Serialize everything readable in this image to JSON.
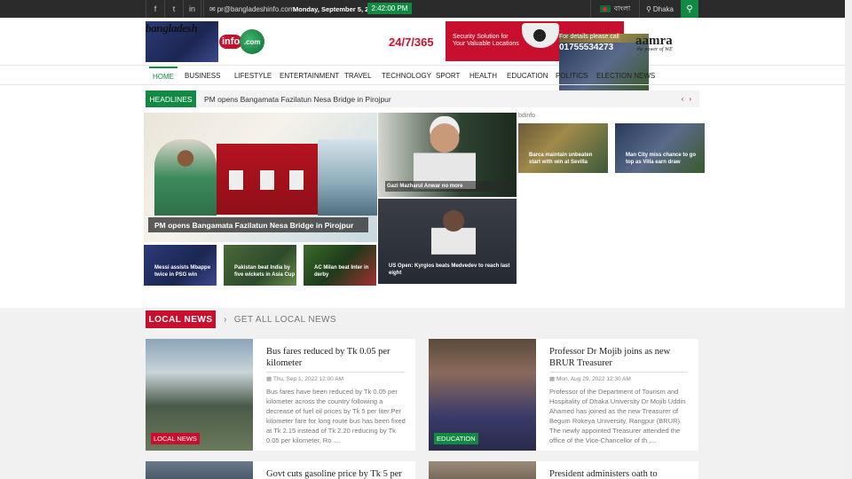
{
  "topbar": {
    "social": [
      "f",
      "t",
      "in"
    ],
    "email": "pr@bangladeshinfo.com",
    "date": "Monday, September 5, 2022",
    "time": "2:42:00 PM",
    "language": "বাংলা",
    "city": "Dhaka"
  },
  "header": {
    "logo_text": "bangladesh",
    "logo_pill": "info",
    "logo_globe": ".com",
    "ad_247": "24/7/365",
    "ad_left": "Security Solution for Your Valuable Locations",
    "ad_right_1": "For details please call",
    "ad_right_2": "01755534273",
    "brand": "aamra",
    "brand_tagline": "the power of WE"
  },
  "nav": [
    "HOME",
    "BUSINESS",
    "LIFESTYLE",
    "ENTERTAINMENT",
    "TRAVEL",
    "TECHNOLOGY",
    "SPORT",
    "HEALTH",
    "EDUCATION",
    "POLITICS",
    "ELECTION NEWS"
  ],
  "headlines": {
    "label": "HEADLINES",
    "text": "PM opens Bangamata Fazilatun Nesa Bridge in Pirojpur",
    "arrows": "‹ ›"
  },
  "hero": {
    "main_caption": "PM opens Bangamata Fazilatun Nesa Bridge in Pirojpur",
    "top_right_caption": "Gazi Mazharul Anwar no more",
    "bottom_right_caption": "US Open: Kyrgios beats Medvedev to reach last eight",
    "broken_image_alt": "bdinfo",
    "side_1": "Barca maintain unbeaten start with win at Sevilla",
    "side_2": "Man City miss chance to go top as Villa earn draw",
    "thumb_1": "Messi assists Mbappe twice in PSG win",
    "thumb_2": "Pakistan beat India by five wickets in Asia Cup",
    "thumb_3": "AC Milan beat Inter in derby"
  },
  "local_news": {
    "title": "LOCAL NEWS",
    "more": "GET ALL LOCAL NEWS",
    "cards": [
      {
        "badge": "LOCAL NEWS",
        "title": "Bus fares reduced by Tk 0.05 per kilometer",
        "date": "Thu, Sep 1, 2022 12:00 AM",
        "excerpt": "Bus fares have been reduced by Tk 0.05 per kilometer across the country following a decrease of fuel oil prices by Tk 5 per liter.Per kilometer fare for long route bus has been fixed at Tk 2.15 instead of Tk 2.20 reducing by Tk 0.05 per kilometer, Ro ...."
      },
      {
        "badge": "EDUCATION",
        "title": "Professor Dr Mojib joins as new BRUR Treasurer",
        "date": "Mon, Aug 29, 2022 12:30 AM",
        "excerpt": "Professor of the Department of Tourism and Hospitality of Dhaka University Dr Mojib Uddin Ahamed has joined as the new Treasurer of Begum Rokeya University, Rangpur (BRUR). The newly appointed Treasurer attended the office of the Vice-Chancellor of th ...."
      },
      {
        "title": "Govt cuts gasoline price by Tk 5 per"
      },
      {
        "title": "President administers oath to"
      }
    ]
  },
  "colors": {
    "green": "#128a43",
    "red": "#c8102e",
    "dark": "#2b2b2b"
  }
}
